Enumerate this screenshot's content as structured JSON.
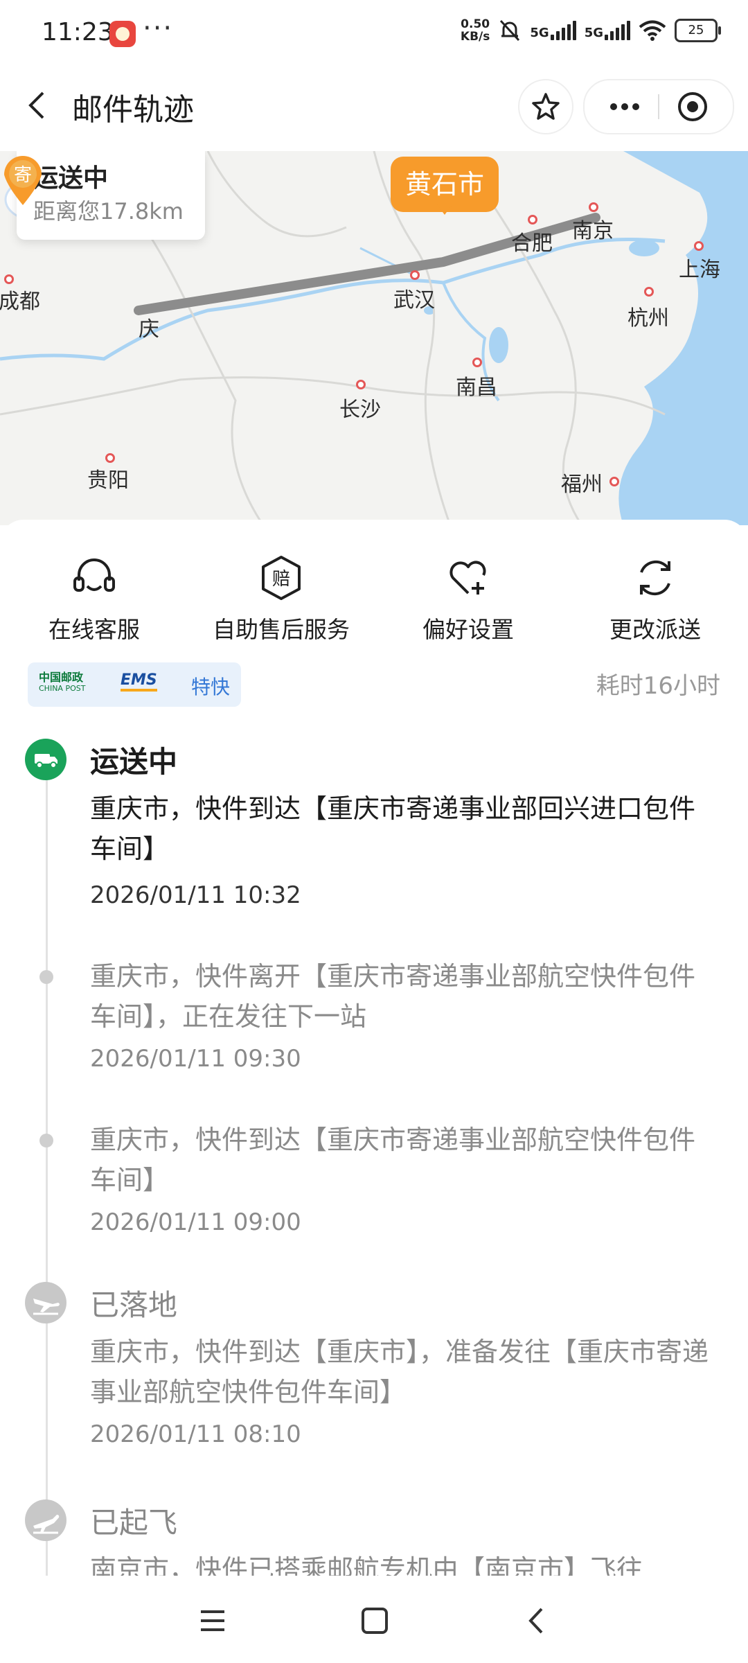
{
  "status_bar": {
    "time": "11:23",
    "more": "···",
    "net_speed_value": "0.50",
    "net_speed_unit": "KB/s",
    "sim1": "5G",
    "sim2": "5G",
    "battery": "25",
    "icons": [
      "app-notification-icon",
      "bell-muted-icon",
      "signal-icon",
      "wifi-icon",
      "battery-icon"
    ]
  },
  "header": {
    "title": "邮件轨迹",
    "icons": [
      "back-icon",
      "star-icon",
      "more-icon",
      "target-icon"
    ]
  },
  "map": {
    "status_title": "运送中",
    "distance": "距离您17.8km",
    "destination_bubble": "黄石市",
    "send_pin_label": "寄",
    "cities": {
      "chengdu": "成都",
      "chongqing": "庆",
      "wuhan": "武汉",
      "hefei": "合肥",
      "nanjing": "南京",
      "shanghai": "上海",
      "hangzhou": "杭州",
      "nanchang": "南昌",
      "changsha": "长沙",
      "guiyang": "贵阳",
      "fuzhou": "福州"
    },
    "colors": {
      "route": "#8c8c8c",
      "water": "#a9d3f3",
      "land": "#f3f3f1",
      "accent": "#f79b2b"
    }
  },
  "actions": [
    {
      "label": "在线客服",
      "icon": "headset-icon"
    },
    {
      "label": "自助售后服务",
      "icon": "compensation-icon"
    },
    {
      "label": "偏好设置",
      "icon": "heart-plus-icon"
    },
    {
      "label": "更改派送",
      "icon": "refresh-icon"
    }
  ],
  "courier": {
    "china_post": "中国邮政",
    "china_post_en": "CHINA POST",
    "ems": "EMS",
    "service": "特快",
    "elapsed": "耗时16小时"
  },
  "timeline": [
    {
      "status": "运送中",
      "desc": "重庆市，快件到达【重庆市寄递事业部回兴进口包件车间】",
      "time": "2026/01/11 10:32"
    },
    {
      "status": "",
      "desc": "重庆市，快件离开【重庆市寄递事业部航空快件包件车间】，正在发往下一站",
      "time": "2026/01/11 09:30"
    },
    {
      "status": "",
      "desc": "重庆市，快件到达【重庆市寄递事业部航空快件包件车间】",
      "time": "2026/01/11 09:00"
    },
    {
      "status": "已落地",
      "desc": "重庆市，快件到达【重庆市】，准备发往【重庆市寄递事业部航空快件包件车间】",
      "time": "2026/01/11 08:10"
    },
    {
      "status": "已起飞",
      "desc": "南京市，快件已搭乘邮航专机由【南京市】飞往",
      "time": ""
    }
  ],
  "navbar": {
    "icons": [
      "menu-icon",
      "home-icon",
      "back-nav-icon"
    ]
  }
}
